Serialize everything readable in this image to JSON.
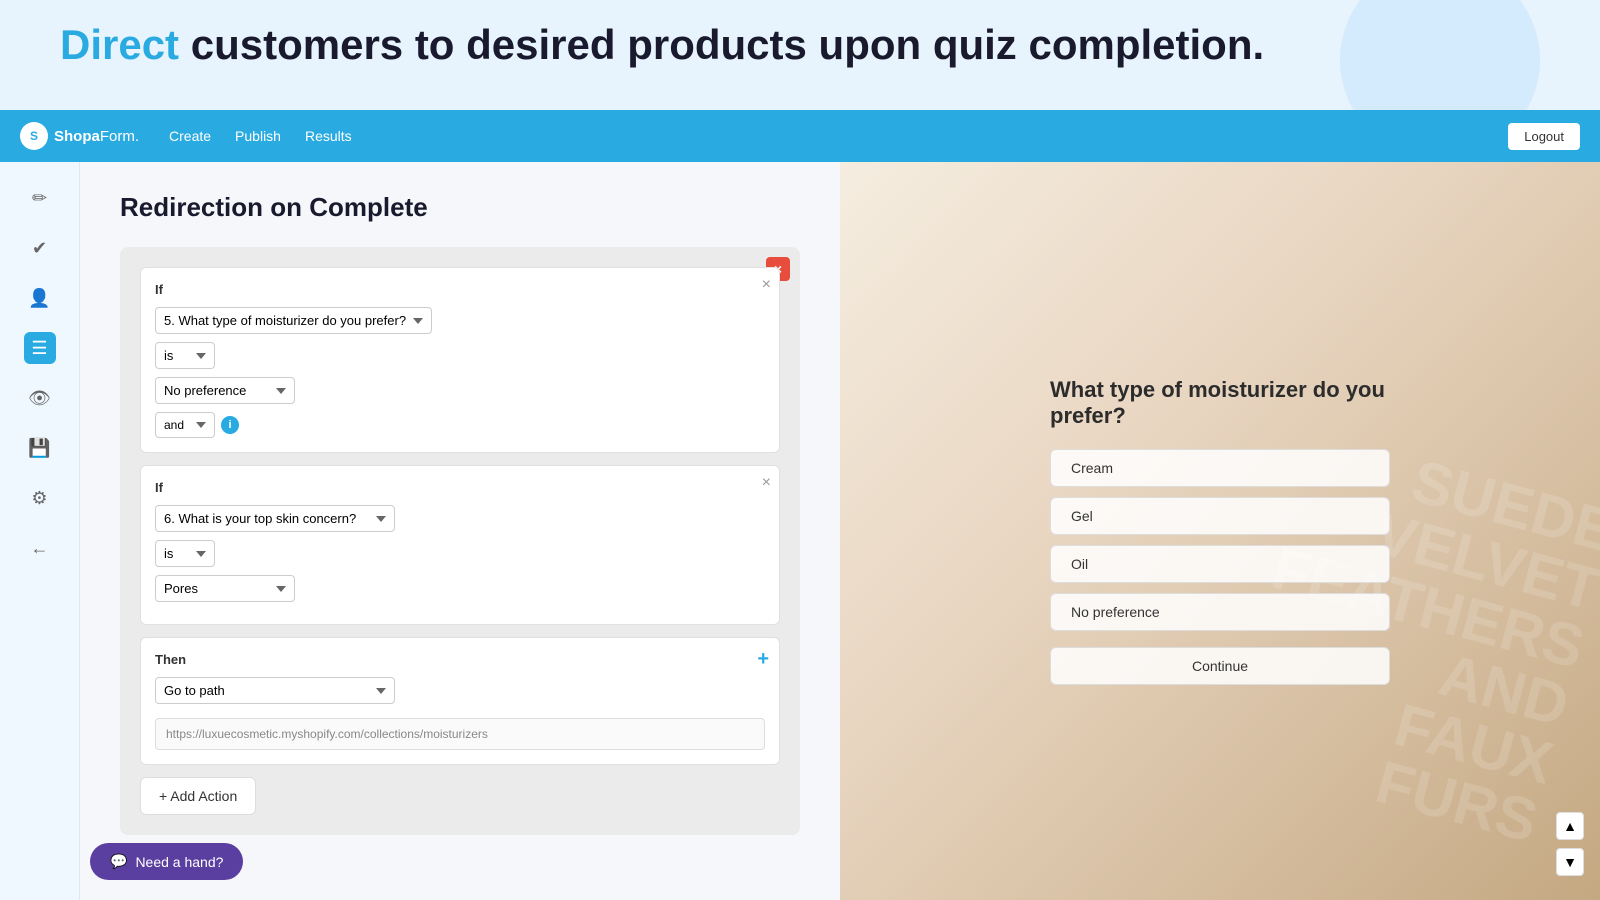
{
  "hero": {
    "heading_highlight": "Direct",
    "heading_rest": " customers to desired products upon quiz completion."
  },
  "navbar": {
    "brand": "ShopaForm.",
    "brand_bold": "Shopa",
    "nav_items": [
      "Create",
      "Publish",
      "Results"
    ],
    "logout_label": "Logout"
  },
  "sidebar": {
    "icons": [
      {
        "name": "pencil-icon",
        "symbol": "✏",
        "active": false
      },
      {
        "name": "check-icon",
        "symbol": "✔",
        "active": false
      },
      {
        "name": "users-icon",
        "symbol": "👤",
        "active": false
      },
      {
        "name": "settings-alt-icon",
        "symbol": "⚙",
        "active": true
      },
      {
        "name": "eye-icon",
        "symbol": "👁",
        "active": false
      },
      {
        "name": "save-icon",
        "symbol": "💾",
        "active": false
      },
      {
        "name": "gear-icon",
        "symbol": "⚙",
        "active": false
      },
      {
        "name": "back-icon",
        "symbol": "←",
        "active": false
      }
    ]
  },
  "panel": {
    "title": "Redirection on Complete",
    "condition1": {
      "label": "If",
      "question": "5. What type of moisturizer do you prefer?",
      "operator": "is",
      "answer": "No preference",
      "connector": "and"
    },
    "condition2": {
      "label": "If",
      "question": "6. What is your top skin concern?",
      "operator": "is",
      "answer": "Pores"
    },
    "then": {
      "label": "Then",
      "action": "Go to path",
      "url": "https://luxuecosmetic.myshopify.com/collections/moisturizers"
    },
    "add_action_label": "+ Add Action"
  },
  "quiz_preview": {
    "question": "What type of moisturizer do you prefer?",
    "options": [
      "Cream",
      "Gel",
      "Oil",
      "No preference"
    ],
    "continue_label": "Continue"
  },
  "need_hand": {
    "label": "Need a hand?"
  },
  "info_icon_label": "i",
  "close_x": "×",
  "plus_label": "+"
}
